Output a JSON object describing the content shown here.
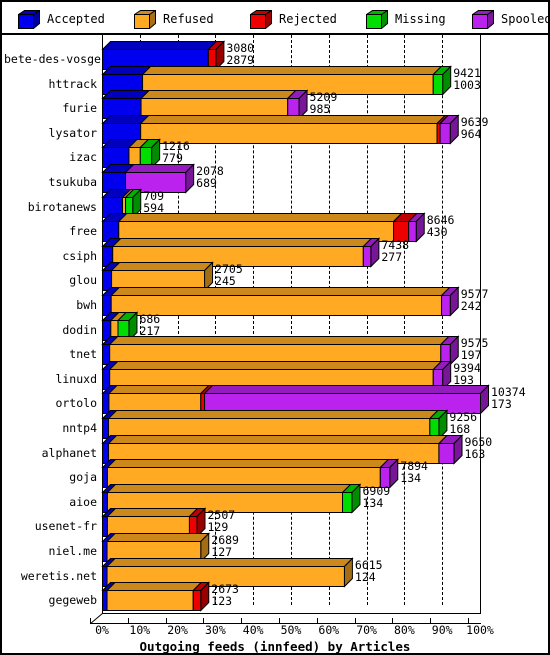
{
  "legend": {
    "items": [
      {
        "label": "Accepted",
        "color": "#0000ee",
        "icon": "cube-icon"
      },
      {
        "label": "Refused",
        "color": "#ffaa22",
        "icon": "cube-icon"
      },
      {
        "label": "Rejected",
        "color": "#ee0000",
        "icon": "cube-icon"
      },
      {
        "label": "Missing",
        "color": "#00dd00",
        "icon": "cube-icon"
      },
      {
        "label": "Spooled",
        "color": "#bb22ee",
        "icon": "cube-icon"
      }
    ]
  },
  "chart_data": {
    "type": "bar",
    "orientation": "horizontal",
    "stacked": true,
    "title": "Outgoing feeds (innfeed) by Articles",
    "xlabel": "Outgoing feeds (innfeed) by Articles",
    "ylabel": "",
    "xlim": [
      0,
      100
    ],
    "x_unit": "percent",
    "grid": true,
    "legend_position": "top",
    "xticks": [
      "0%",
      "10%",
      "20%",
      "30%",
      "40%",
      "50%",
      "60%",
      "70%",
      "80%",
      "90%",
      "100%"
    ],
    "xtick_values": [
      0,
      10,
      20,
      30,
      40,
      50,
      60,
      70,
      80,
      90,
      100
    ],
    "series_names": [
      "Accepted",
      "Refused",
      "Rejected",
      "Missing",
      "Spooled"
    ],
    "categories": [
      "bete-des-vosges",
      "httrack",
      "furie",
      "lysator",
      "izac",
      "tsukuba",
      "birotanews",
      "free",
      "csiph",
      "glou",
      "bwh",
      "dodin",
      "tnet",
      "linuxd",
      "ortolo",
      "nntp4",
      "alphanet",
      "goja",
      "aioe",
      "usenet-fr",
      "niel.me",
      "weretis.net",
      "gegeweb"
    ],
    "rows": [
      {
        "category": "bete-des-vosges",
        "total": 3080,
        "accepted": 2879,
        "total_pct": 30.0,
        "segments": [
          {
            "name": "Accepted",
            "pct": 28.0
          },
          {
            "name": "Rejected",
            "pct": 2.0
          }
        ]
      },
      {
        "category": "httrack",
        "total": 9421,
        "accepted": 1003,
        "total_pct": 90.0,
        "segments": [
          {
            "name": "Accepted",
            "pct": 10.6
          },
          {
            "name": "Refused",
            "pct": 76.9
          },
          {
            "name": "Missing",
            "pct": 2.5
          }
        ]
      },
      {
        "category": "furie",
        "total": 5209,
        "accepted": 985,
        "total_pct": 52.0,
        "segments": [
          {
            "name": "Accepted",
            "pct": 10.2
          },
          {
            "name": "Refused",
            "pct": 38.8
          },
          {
            "name": "Spooled",
            "pct": 3.0
          }
        ]
      },
      {
        "category": "lysator",
        "total": 9639,
        "accepted": 964,
        "total_pct": 92.0,
        "segments": [
          {
            "name": "Accepted",
            "pct": 10.1
          },
          {
            "name": "Refused",
            "pct": 78.4
          },
          {
            "name": "Rejected",
            "pct": 0.8
          },
          {
            "name": "Spooled",
            "pct": 2.7
          }
        ]
      },
      {
        "category": "izac",
        "total": 1216,
        "accepted": 779,
        "total_pct": 13.0,
        "segments": [
          {
            "name": "Accepted",
            "pct": 7.0
          },
          {
            "name": "Refused",
            "pct": 3.0
          },
          {
            "name": "Missing",
            "pct": 3.0
          }
        ]
      },
      {
        "category": "tsukuba",
        "total": 2078,
        "accepted": 689,
        "total_pct": 22.0,
        "segments": [
          {
            "name": "Accepted",
            "pct": 6.1
          },
          {
            "name": "Spooled",
            "pct": 15.9
          }
        ]
      },
      {
        "category": "birotanews",
        "total": 709,
        "accepted": 594,
        "total_pct": 8.0,
        "segments": [
          {
            "name": "Accepted",
            "pct": 5.3
          },
          {
            "name": "Refused",
            "pct": 0.8
          },
          {
            "name": "Missing",
            "pct": 1.9
          }
        ]
      },
      {
        "category": "free",
        "total": 8646,
        "accepted": 430,
        "total_pct": 83.0,
        "segments": [
          {
            "name": "Accepted",
            "pct": 4.3
          },
          {
            "name": "Refused",
            "pct": 72.7
          },
          {
            "name": "Rejected",
            "pct": 4.0
          },
          {
            "name": "Spooled",
            "pct": 2.0
          }
        ]
      },
      {
        "category": "csiph",
        "total": 7438,
        "accepted": 277,
        "total_pct": 71.0,
        "segments": [
          {
            "name": "Accepted",
            "pct": 2.7
          },
          {
            "name": "Refused",
            "pct": 66.3
          },
          {
            "name": "Spooled",
            "pct": 2.0
          }
        ]
      },
      {
        "category": "glou",
        "total": 2705,
        "accepted": 245,
        "total_pct": 27.0,
        "segments": [
          {
            "name": "Accepted",
            "pct": 2.4
          },
          {
            "name": "Refused",
            "pct": 24.6
          }
        ]
      },
      {
        "category": "bwh",
        "total": 9577,
        "accepted": 242,
        "total_pct": 92.0,
        "segments": [
          {
            "name": "Accepted",
            "pct": 2.3
          },
          {
            "name": "Refused",
            "pct": 87.4
          },
          {
            "name": "Spooled",
            "pct": 2.3
          }
        ]
      },
      {
        "category": "dodin",
        "total": 686,
        "accepted": 217,
        "total_pct": 7.0,
        "segments": [
          {
            "name": "Accepted",
            "pct": 2.2
          },
          {
            "name": "Refused",
            "pct": 1.9
          },
          {
            "name": "Missing",
            "pct": 2.9
          }
        ]
      },
      {
        "category": "tnet",
        "total": 9575,
        "accepted": 197,
        "total_pct": 92.0,
        "segments": [
          {
            "name": "Accepted",
            "pct": 1.9
          },
          {
            "name": "Refused",
            "pct": 87.6
          },
          {
            "name": "Spooled",
            "pct": 2.5
          }
        ]
      },
      {
        "category": "linuxd",
        "total": 9394,
        "accepted": 193,
        "total_pct": 90.0,
        "segments": [
          {
            "name": "Accepted",
            "pct": 1.9
          },
          {
            "name": "Refused",
            "pct": 85.6
          },
          {
            "name": "Spooled",
            "pct": 2.5
          }
        ]
      },
      {
        "category": "ortolo",
        "total": 10374,
        "accepted": 173,
        "total_pct": 100.0,
        "segments": [
          {
            "name": "Accepted",
            "pct": 1.7
          },
          {
            "name": "Refused",
            "pct": 24.3
          },
          {
            "name": "Rejected",
            "pct": 1.0
          },
          {
            "name": "Spooled",
            "pct": 73.0
          }
        ]
      },
      {
        "category": "nntp4",
        "total": 9256,
        "accepted": 168,
        "total_pct": 89.0,
        "segments": [
          {
            "name": "Accepted",
            "pct": 1.6
          },
          {
            "name": "Refused",
            "pct": 85.0
          },
          {
            "name": "Missing",
            "pct": 2.4
          }
        ]
      },
      {
        "category": "alphanet",
        "total": 9650,
        "accepted": 163,
        "total_pct": 93.0,
        "segments": [
          {
            "name": "Accepted",
            "pct": 1.6
          },
          {
            "name": "Refused",
            "pct": 87.4
          },
          {
            "name": "Spooled",
            "pct": 4.0
          }
        ]
      },
      {
        "category": "goja",
        "total": 7894,
        "accepted": 134,
        "total_pct": 76.0,
        "segments": [
          {
            "name": "Accepted",
            "pct": 1.3
          },
          {
            "name": "Refused",
            "pct": 72.2
          },
          {
            "name": "Spooled",
            "pct": 2.5
          }
        ]
      },
      {
        "category": "aioe",
        "total": 6909,
        "accepted": 134,
        "total_pct": 66.0,
        "segments": [
          {
            "name": "Accepted",
            "pct": 1.3
          },
          {
            "name": "Refused",
            "pct": 62.2
          },
          {
            "name": "Missing",
            "pct": 2.5
          }
        ]
      },
      {
        "category": "usenet-fr",
        "total": 2507,
        "accepted": 129,
        "total_pct": 25.0,
        "segments": [
          {
            "name": "Accepted",
            "pct": 1.3
          },
          {
            "name": "Refused",
            "pct": 21.7
          },
          {
            "name": "Rejected",
            "pct": 2.0
          }
        ]
      },
      {
        "category": "niel.me",
        "total": 2689,
        "accepted": 127,
        "total_pct": 26.0,
        "segments": [
          {
            "name": "Accepted",
            "pct": 1.2
          },
          {
            "name": "Refused",
            "pct": 24.8
          }
        ]
      },
      {
        "category": "weretis.net",
        "total": 6615,
        "accepted": 124,
        "total_pct": 64.0,
        "segments": [
          {
            "name": "Accepted",
            "pct": 1.2
          },
          {
            "name": "Refused",
            "pct": 62.8
          }
        ]
      },
      {
        "category": "gegeweb",
        "total": 2673,
        "accepted": 123,
        "total_pct": 26.0,
        "segments": [
          {
            "name": "Accepted",
            "pct": 1.2
          },
          {
            "name": "Refused",
            "pct": 22.8
          },
          {
            "name": "Rejected",
            "pct": 2.0
          }
        ]
      }
    ]
  },
  "colors": {
    "accepted": "#0000ee",
    "refused": "#ffaa22",
    "rejected": "#ee0000",
    "missing": "#00dd00",
    "spooled": "#bb22ee",
    "background": "#ffffff",
    "axis": "#000000"
  }
}
